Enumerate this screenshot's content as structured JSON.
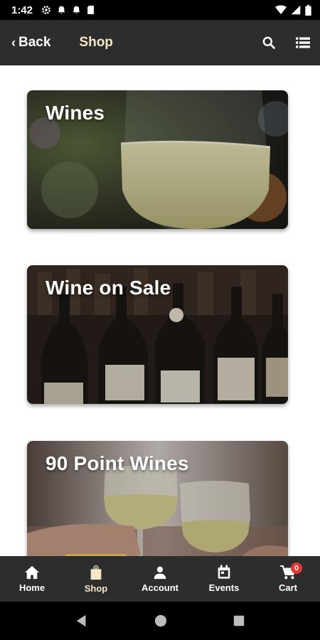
{
  "status_bar": {
    "time": "1:42"
  },
  "app_bar": {
    "back_label": "Back",
    "title": "Shop"
  },
  "categories": [
    {
      "title": "Wines"
    },
    {
      "title": "Wine on Sale"
    },
    {
      "title": "90 Point Wines"
    }
  ],
  "bottom_nav": {
    "items": [
      {
        "label": "Home",
        "icon": "home-icon"
      },
      {
        "label": "Shop",
        "icon": "shopping-bag-icon"
      },
      {
        "label": "Account",
        "icon": "person-icon"
      },
      {
        "label": "Events",
        "icon": "calendar-icon"
      },
      {
        "label": "Cart",
        "icon": "cart-icon"
      }
    ],
    "active": "Shop",
    "cart_badge": "0"
  },
  "colors": {
    "bar": "#2d2d2d",
    "title_accent": "#f5e6c8",
    "active_indicator": "#c9a24a",
    "badge": "#e53935"
  }
}
